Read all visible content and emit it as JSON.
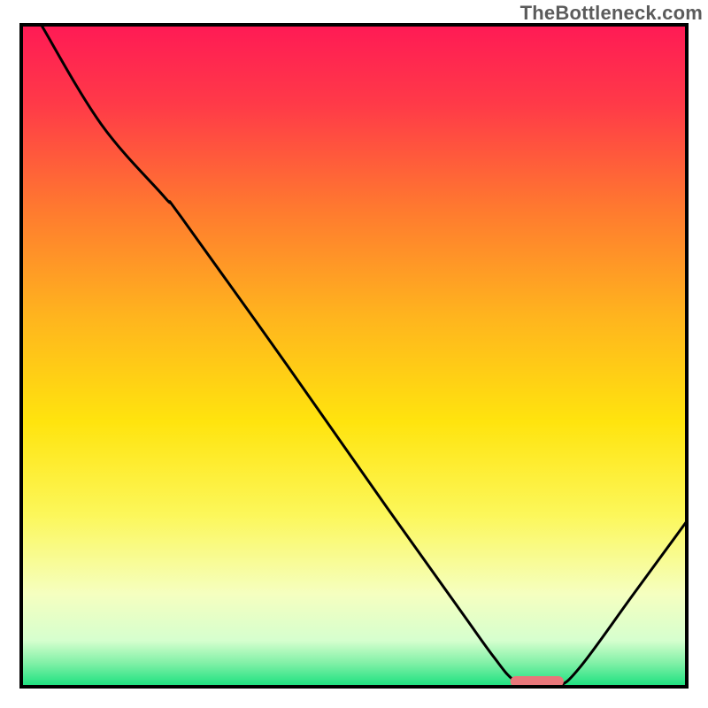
{
  "watermark": "TheBottleneck.com",
  "chart_data": {
    "type": "line",
    "title": "",
    "xlabel": "",
    "ylabel": "",
    "xlim": [
      0,
      100
    ],
    "ylim": [
      0,
      100
    ],
    "axes_visible": false,
    "grid": false,
    "background_gradient": {
      "type": "vertical",
      "stops": [
        {
          "pos": 0.0,
          "color": "#ff1a55"
        },
        {
          "pos": 0.12,
          "color": "#ff3a48"
        },
        {
          "pos": 0.28,
          "color": "#ff7a2f"
        },
        {
          "pos": 0.44,
          "color": "#ffb41e"
        },
        {
          "pos": 0.6,
          "color": "#ffe40e"
        },
        {
          "pos": 0.74,
          "color": "#fcf75a"
        },
        {
          "pos": 0.86,
          "color": "#f5ffc0"
        },
        {
          "pos": 0.93,
          "color": "#d6ffce"
        },
        {
          "pos": 0.965,
          "color": "#7ff0a6"
        },
        {
          "pos": 1.0,
          "color": "#18e07e"
        }
      ]
    },
    "series": [
      {
        "name": "bottleneck-curve",
        "stroke": "#000000",
        "stroke_width": 3,
        "points": [
          {
            "x": 3.0,
            "y": 100.0
          },
          {
            "x": 12.0,
            "y": 85.0
          },
          {
            "x": 21.5,
            "y": 74.0
          },
          {
            "x": 24.0,
            "y": 71.0
          },
          {
            "x": 40.0,
            "y": 48.5
          },
          {
            "x": 55.0,
            "y": 27.0
          },
          {
            "x": 66.0,
            "y": 11.5
          },
          {
            "x": 71.0,
            "y": 4.5
          },
          {
            "x": 74.0,
            "y": 1.0
          },
          {
            "x": 77.0,
            "y": 0.0
          },
          {
            "x": 80.5,
            "y": 0.0
          },
          {
            "x": 84.0,
            "y": 3.0
          },
          {
            "x": 92.0,
            "y": 14.0
          },
          {
            "x": 100.0,
            "y": 25.0
          }
        ]
      }
    ],
    "marker": {
      "name": "optimal-range",
      "shape": "rounded-rect",
      "fill": "#e8777a",
      "x_start": 73.5,
      "x_end": 81.5,
      "y": 0.8,
      "height_pct": 1.6
    },
    "frame": {
      "stroke": "#000000",
      "stroke_width": 4
    }
  }
}
